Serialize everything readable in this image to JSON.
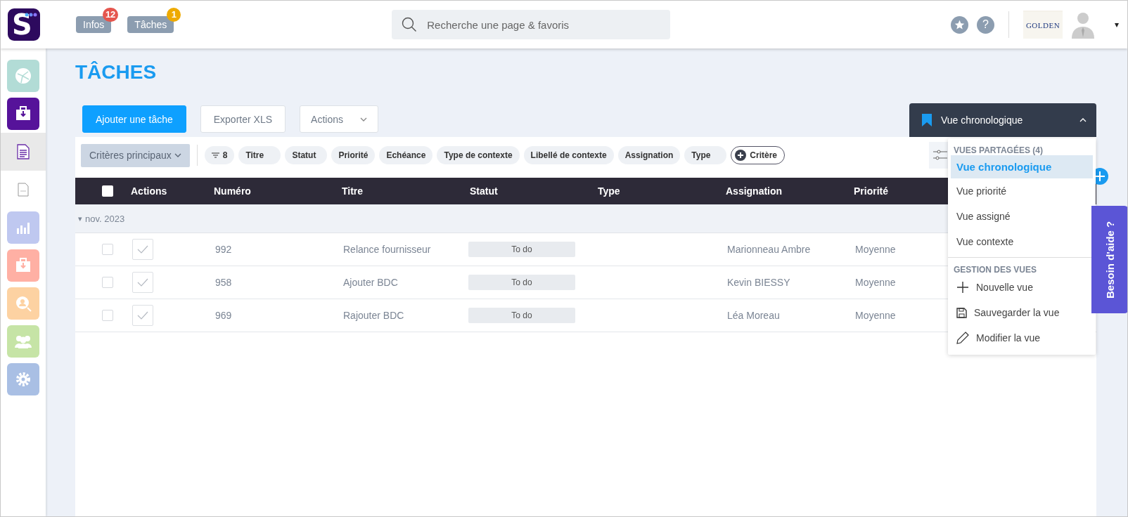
{
  "topbar": {
    "logo": "S",
    "buttons": [
      {
        "label": "Infos",
        "badge": "12",
        "color": "#e5564e"
      },
      {
        "label": "Tâches",
        "badge": "1",
        "color": "#eeaa00"
      }
    ],
    "search": {
      "placeholder": "Recherche une page & favoris"
    },
    "help_button": "?",
    "company_logo": "GOLDEN",
    "menu_caret": "▾"
  },
  "sidebar": {
    "items": [
      {
        "kind": "tile",
        "color": "#b2dcd6",
        "selected": false
      },
      {
        "kind": "tile",
        "color": "#56139a",
        "selected": false
      },
      {
        "kind": "plain",
        "selected": true
      },
      {
        "kind": "plain",
        "selected": false
      },
      {
        "kind": "tile",
        "color": "#bfc8f0",
        "selected": false
      },
      {
        "kind": "tile",
        "color": "#ffb0a4",
        "selected": false
      },
      {
        "kind": "tile",
        "color": "#fdd2a2",
        "selected": false
      },
      {
        "kind": "tile",
        "color": "#c6e4a6",
        "selected": false
      },
      {
        "kind": "tile",
        "color": "#a9bfe4",
        "selected": false
      }
    ]
  },
  "page": {
    "title": "TÂCHES",
    "toolbar": [
      {
        "label": "Ajouter une tâche",
        "kind": "primary"
      },
      {
        "label": "Exporter XLS",
        "kind": "secondary"
      },
      {
        "label": "Actions",
        "kind": "dropdown"
      }
    ],
    "view_selector": {
      "label": "Vue chronologique",
      "expanded": true
    }
  },
  "filters": {
    "main": "Critères principaux",
    "count": "8",
    "chips": [
      "Titre",
      "Statut",
      "Priorité",
      "Echéance",
      "Type de contexte",
      "Libellé de contexte",
      "Assignation",
      "Type"
    ],
    "add": "Critère"
  },
  "table": {
    "header_checkbox": {
      "checked": false
    },
    "columns": [
      "Actions",
      "Numéro",
      "Titre",
      "Statut",
      "Type",
      "Assignation",
      "Priorité"
    ],
    "group": {
      "toggle": "▾",
      "label": "nov. 2023"
    },
    "rows": [
      {
        "checked": false,
        "number": "992",
        "title": "Relance fournisseur",
        "status": "To do",
        "assignee": "Marionneau Ambre",
        "priority": "Moyenne"
      },
      {
        "checked": false,
        "number": "958",
        "title": "Ajouter BDC",
        "status": "To do",
        "assignee": "Kevin BIESSY",
        "priority": "Moyenne"
      },
      {
        "checked": false,
        "number": "969",
        "title": "Rajouter BDC",
        "status": "To do",
        "assignee": "Léa Moreau",
        "priority": "Moyenne"
      }
    ]
  },
  "views_menu": {
    "sections": [
      {
        "heading": "VUES PARTAGÉES (4)",
        "items": [
          {
            "label": "Vue chronologique",
            "selected": true
          },
          {
            "label": "Vue priorité",
            "selected": false
          },
          {
            "label": "Vue assigné",
            "selected": false
          },
          {
            "label": "Vue contexte",
            "selected": false
          }
        ]
      },
      {
        "heading": "GESTION DES VUES",
        "items": [
          {
            "label": "Nouvelle vue",
            "kind": "add"
          },
          {
            "label": "Sauvegarder la vue",
            "kind": "save"
          },
          {
            "label": "Modifier la vue",
            "kind": "edit"
          }
        ]
      }
    ]
  },
  "help_tab": "Besoin d'aide ?"
}
